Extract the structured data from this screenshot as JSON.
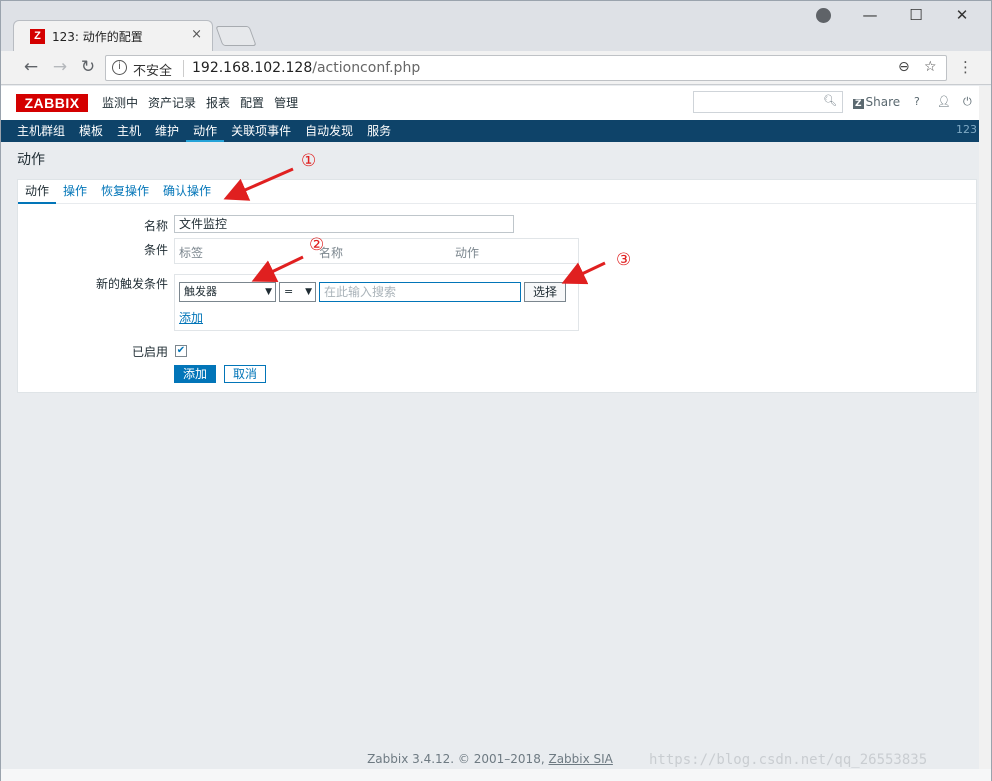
{
  "browser": {
    "tab_favicon": "Z",
    "tab_title": "123: 动作的配置",
    "tab_close": "×",
    "insecure_label": "不安全",
    "url_host": "192.168.102.128",
    "url_path": "/actionconf.php",
    "window_controls": [
      "—",
      "☐",
      "✕"
    ]
  },
  "zabbix": {
    "logo": "ZABBIX",
    "top_menu": [
      "监测中",
      "资产记录",
      "报表",
      "配置",
      "管理"
    ],
    "share_label": "Share",
    "share_badge": "Z",
    "sub_menu": [
      "主机群组",
      "模板",
      "主机",
      "维护",
      "动作",
      "关联项事件",
      "自动发现",
      "服务"
    ],
    "sub_menu_active": "动作",
    "sub_menu_right": "123",
    "page_title": "动作"
  },
  "form": {
    "tabs": [
      "动作",
      "操作",
      "恢复操作",
      "确认操作"
    ],
    "name_label": "名称",
    "name_value": "文件监控",
    "conditions_label": "条件",
    "conditions_columns": [
      "标签",
      "名称",
      "动作"
    ],
    "new_condition_label": "新的触发条件",
    "condition_type": "触发器",
    "operator": "=",
    "search_placeholder": "在此输入搜索",
    "choose_button": "选择",
    "add_link": "添加",
    "enabled_label": "已启用",
    "enabled": true,
    "add_button": "添加",
    "cancel_button": "取消"
  },
  "annotations": [
    "①",
    "②",
    "③"
  ],
  "footer": {
    "text": "Zabbix 3.4.12. © 2001–2018, ",
    "link": "Zabbix SIA"
  },
  "watermark": "https://blog.csdn.net/qq_26553835",
  "colors": {
    "brand_red": "#d40000",
    "nav_blue": "#0e4369",
    "link_blue": "#0275b8",
    "annotation_red": "#e02020"
  }
}
